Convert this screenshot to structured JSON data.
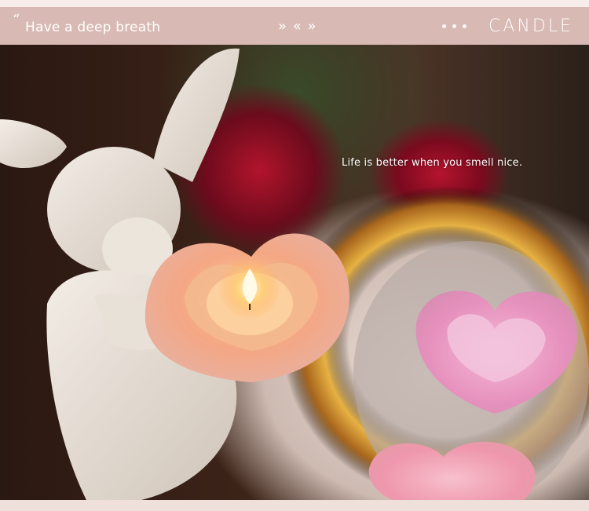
{
  "header": {
    "quote_mark": "“",
    "tagline": "Have a deep breath",
    "arrows": "» « »",
    "brand": "CANDLE"
  },
  "photo": {
    "caption": "Life is better when you smell nice."
  },
  "colors": {
    "header_bg": "#d8b9b3",
    "page_bg": "#f3e6e2"
  }
}
